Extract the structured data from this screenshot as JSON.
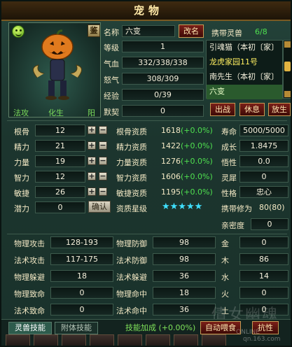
{
  "window": {
    "title": "宠物"
  },
  "portrait": {
    "face_icon": "smiley-face-icon",
    "appraise_label": "鉴",
    "elements": [
      "法攻",
      "化生",
      "阳"
    ]
  },
  "info": {
    "name_label": "名称",
    "name_value": "六变",
    "rename_label": "改名",
    "level_label": "等级",
    "level_value": "1",
    "hp_label": "气血",
    "hp_value": "332/338/338",
    "mp_label": "怒气",
    "mp_value": "308/309",
    "exp_label": "经验",
    "exp_value": "0/39",
    "tacit_label": "默契",
    "tacit_value": "0"
  },
  "carry": {
    "label": "携带灵兽",
    "count": "6/8",
    "pets": [
      {
        "name": "引魂猫（本初〔家〕"
      },
      {
        "name": "龙虎家园11号"
      },
      {
        "name": "南先生（本初〔家〕"
      },
      {
        "name": ""
      },
      {
        "name": "六变"
      }
    ]
  },
  "actions": {
    "battle": "出战",
    "rest": "休息",
    "release": "放生"
  },
  "attrs": [
    {
      "label": "根骨",
      "value": "12"
    },
    {
      "label": "精力",
      "value": "21"
    },
    {
      "label": "力量",
      "value": "19"
    },
    {
      "label": "智力",
      "value": "12"
    },
    {
      "label": "敏捷",
      "value": "26"
    }
  ],
  "potential": {
    "label": "潜力",
    "value": "0",
    "confirm": "确认"
  },
  "aptitudes": [
    {
      "label": "根骨资质",
      "value": "1618",
      "delta": "(+0.0%)"
    },
    {
      "label": "精力资质",
      "value": "1422",
      "delta": "(+0.0%)"
    },
    {
      "label": "力量资质",
      "value": "1276",
      "delta": "(+0.0%)"
    },
    {
      "label": "智力资质",
      "value": "1606",
      "delta": "(+0.0%)"
    },
    {
      "label": "敏捷资质",
      "value": "1195",
      "delta": "(+0.0%)"
    }
  ],
  "star_level": {
    "label": "资质星级",
    "stars": "★★★★★",
    "count": 5
  },
  "right_stats": [
    {
      "label": "寿命",
      "value": "5000/5000"
    },
    {
      "label": "成长",
      "value": "1.8475"
    },
    {
      "label": "悟性",
      "value": "0.0"
    },
    {
      "label": "灵犀",
      "value": "0"
    },
    {
      "label": "性格",
      "value": "忠心"
    },
    {
      "label": "携带修为",
      "value": "80(80)"
    },
    {
      "label": "亲密度",
      "value": "0"
    }
  ],
  "combat_left": [
    {
      "label": "物理攻击",
      "value": "128-193"
    },
    {
      "label": "法术攻击",
      "value": "117-175"
    },
    {
      "label": "物理躲避",
      "value": "18"
    },
    {
      "label": "物理致命",
      "value": "0"
    },
    {
      "label": "法术致命",
      "value": "0"
    }
  ],
  "combat_mid": [
    {
      "label": "物理防御",
      "value": "98"
    },
    {
      "label": "法术防御",
      "value": "98"
    },
    {
      "label": "法术躲避",
      "value": "36"
    },
    {
      "label": "物理命中",
      "value": "18"
    },
    {
      "label": "法术命中",
      "value": "36"
    }
  ],
  "combat_elem": [
    {
      "label": "金",
      "value": "0"
    },
    {
      "label": "木",
      "value": "86"
    },
    {
      "label": "水",
      "value": "14"
    },
    {
      "label": "火",
      "value": "0"
    },
    {
      "label": "土",
      "value": "0"
    }
  ],
  "bottom": {
    "tab_skills": "灵兽技能",
    "tab_attached": "附体技能",
    "bonus_label": "技能加成",
    "bonus_value": "(+0.00%)",
    "auto_feed": "自动喂食",
    "extra_button": "抗性"
  },
  "watermark": {
    "text": "倩女幽魂",
    "sub": "qn.163.com",
    "sub2": "ONLINE"
  },
  "colors": {
    "accent_gold": "#c69a54",
    "positive_green": "#4fe04f",
    "star_cyan": "#3fe0ff"
  }
}
